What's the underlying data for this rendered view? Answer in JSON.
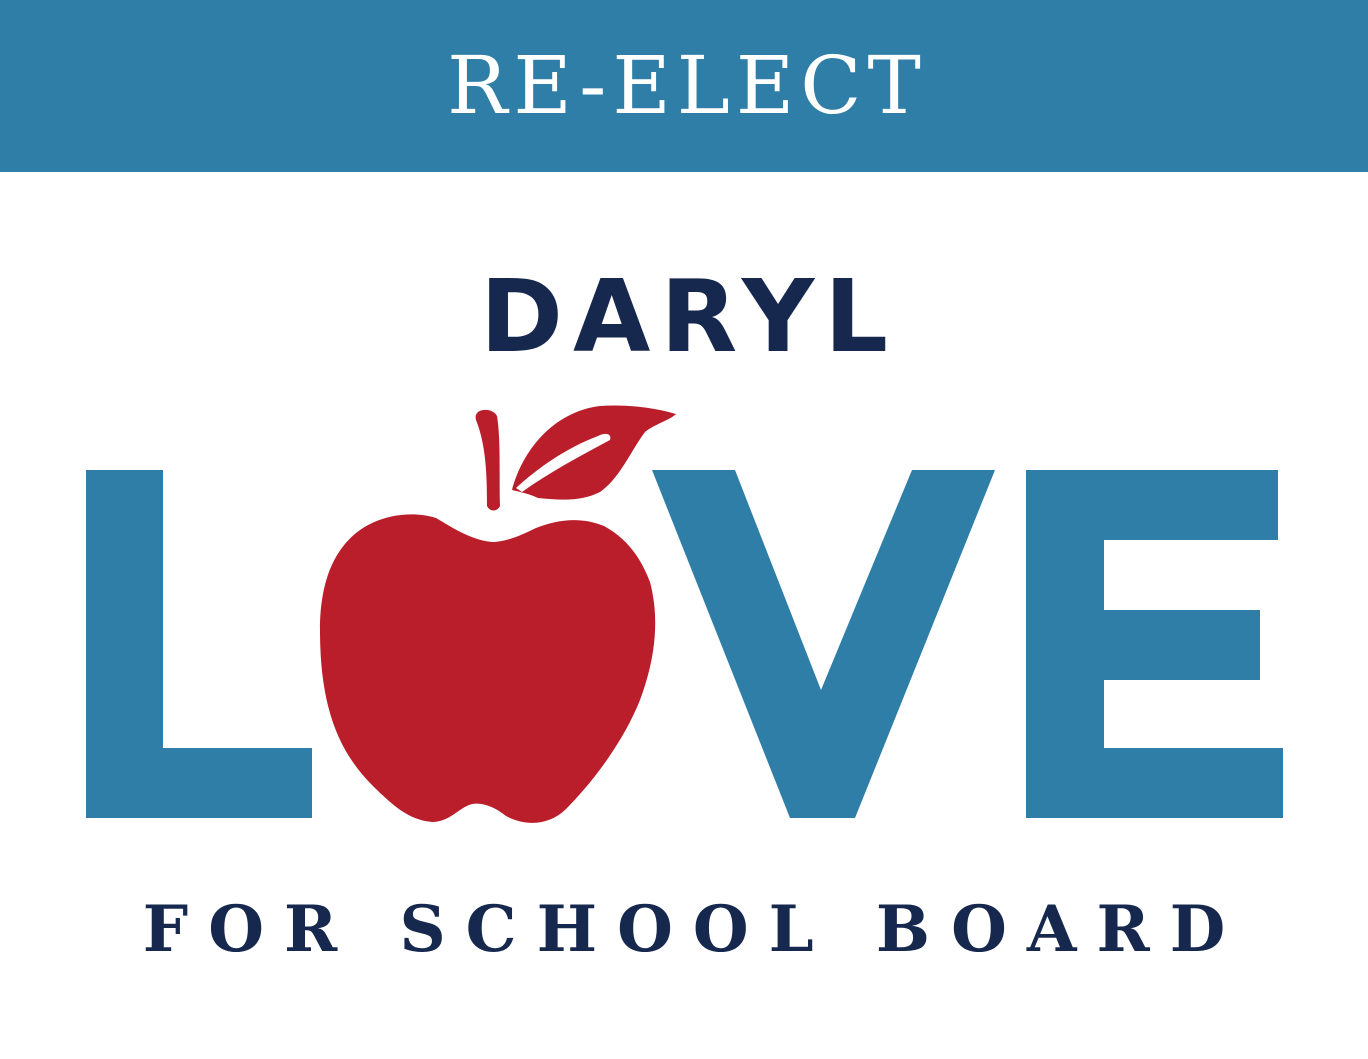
{
  "banner": {
    "text": "RE-ELECT",
    "color": "#2e7ea8"
  },
  "candidate": {
    "first_name": "DARYL",
    "last_name": "LOVE"
  },
  "tagline": "FOR SCHOOL BOARD",
  "logo": {
    "apple_icon": "apple-icon",
    "colors": {
      "navy": "#17284f",
      "blue": "#2e7ea8",
      "red": "#bb1e2b"
    }
  }
}
